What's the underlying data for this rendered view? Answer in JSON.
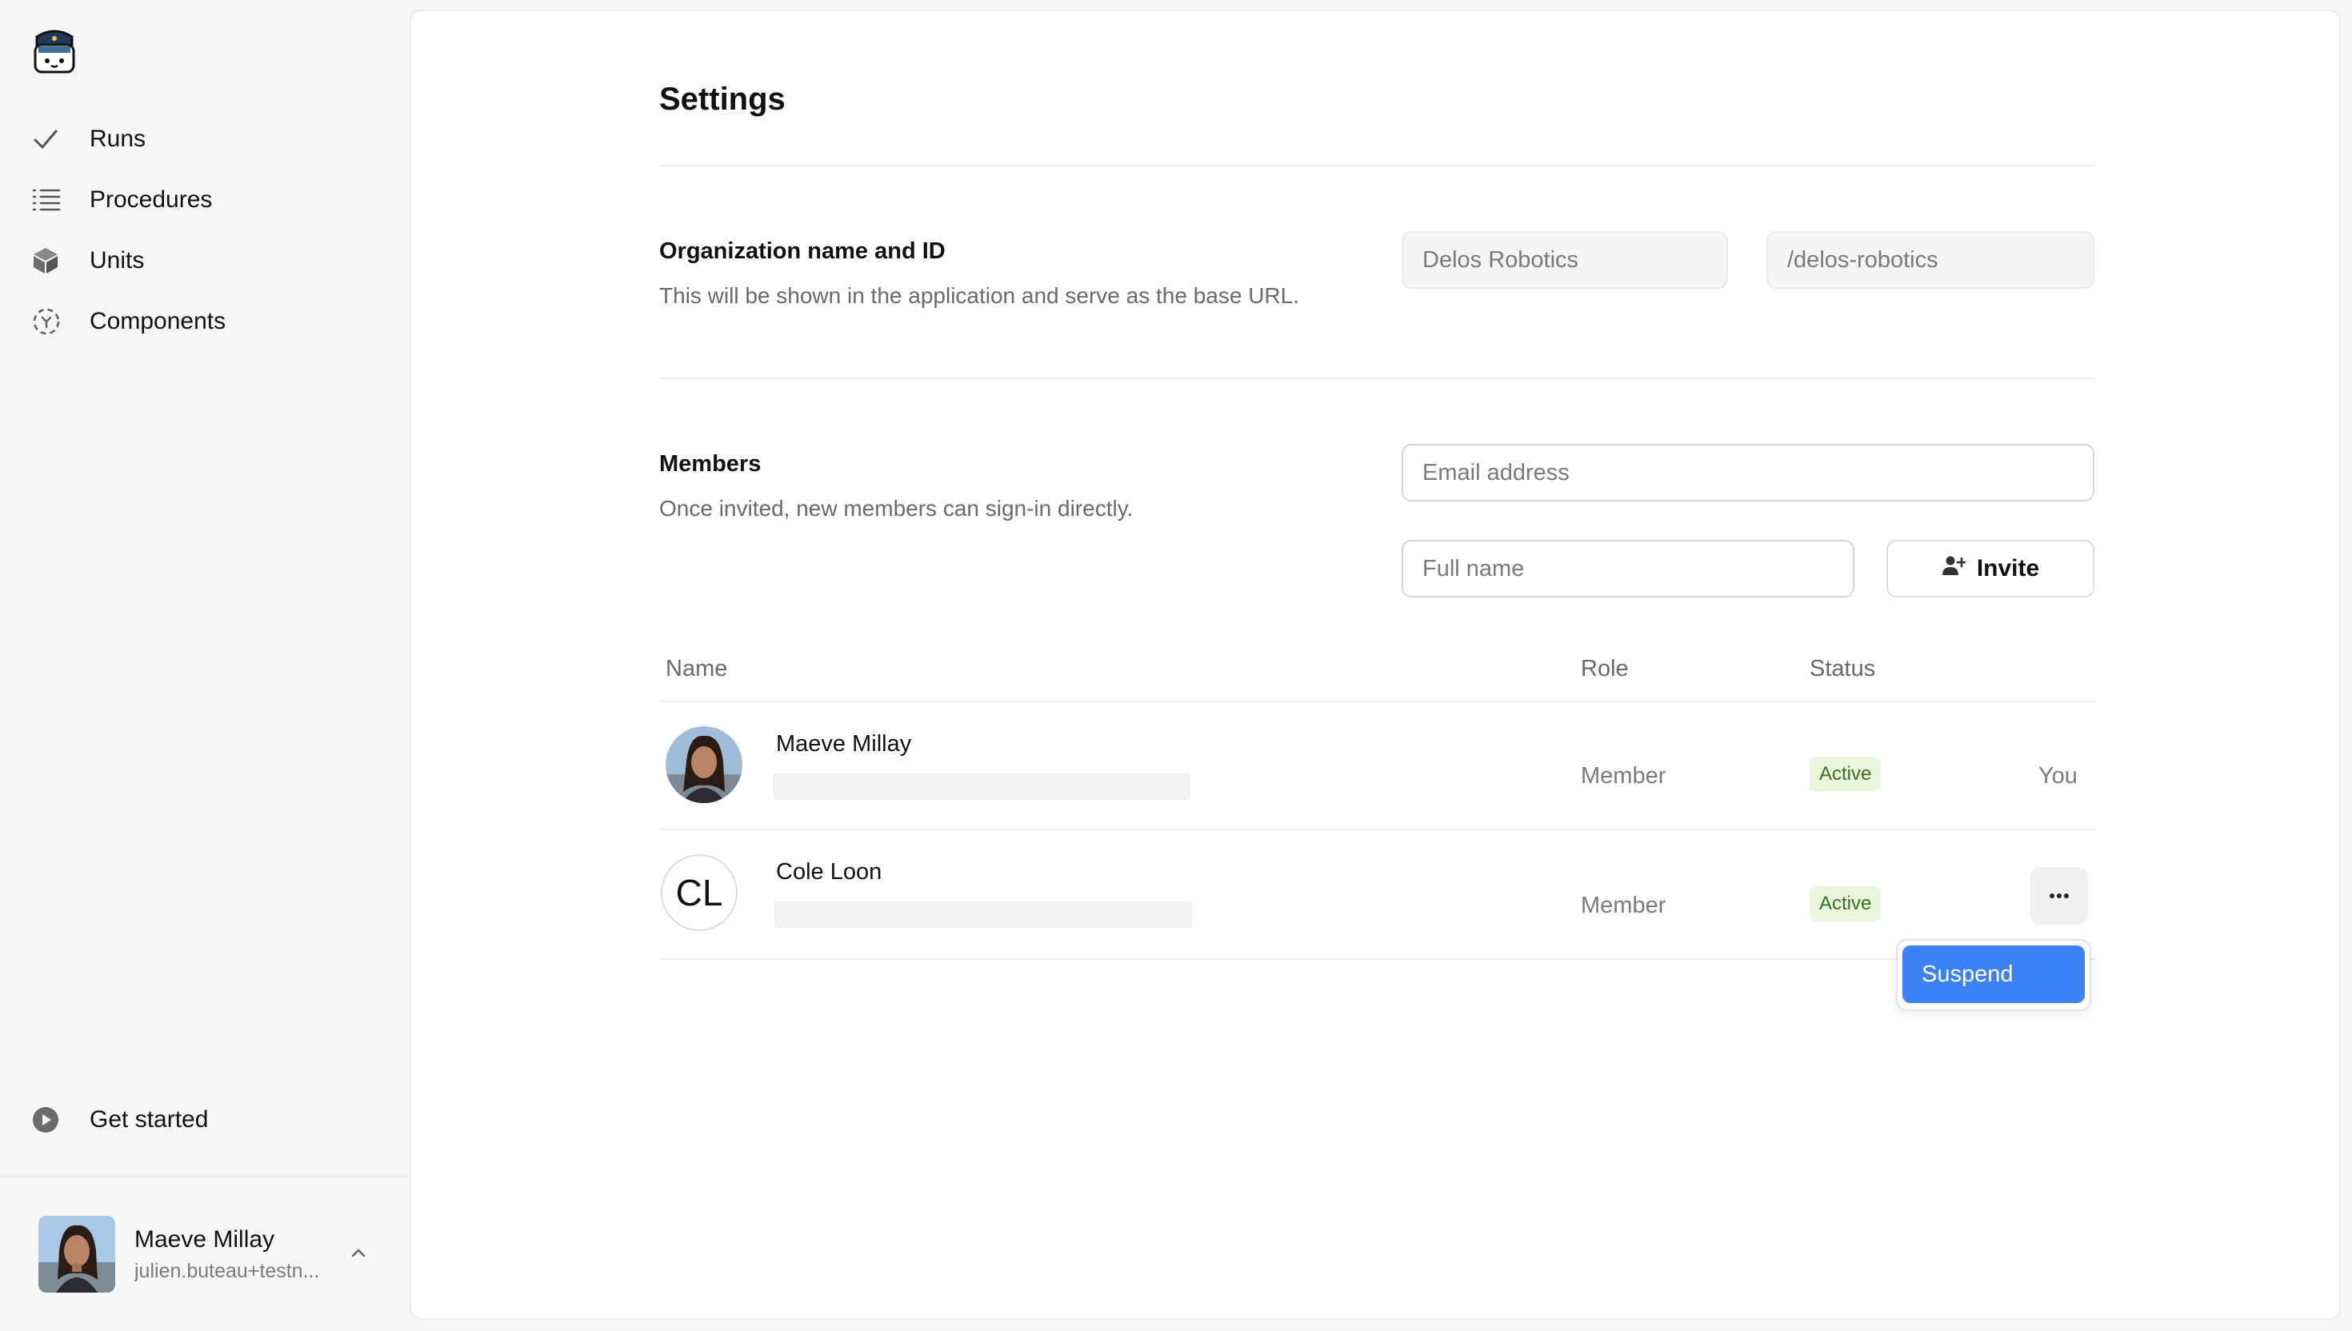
{
  "sidebar": {
    "nav": [
      {
        "label": "Runs",
        "icon": "check-icon"
      },
      {
        "label": "Procedures",
        "icon": "list-icon"
      },
      {
        "label": "Units",
        "icon": "cube-icon"
      },
      {
        "label": "Components",
        "icon": "components-icon"
      }
    ],
    "get_started": "Get started",
    "user": {
      "name": "Maeve Millay",
      "email": "julien.buteau+testn..."
    }
  },
  "page": {
    "title": "Settings"
  },
  "org": {
    "title": "Organization name and ID",
    "description": "This will be shown in the application and serve as the base URL.",
    "name_value": "Delos Robotics",
    "id_value": "/delos-robotics"
  },
  "members": {
    "title": "Members",
    "description": "Once invited, new members can sign-in directly.",
    "email_placeholder": "Email address",
    "fullname_placeholder": "Full name",
    "invite_label": "Invite",
    "columns": {
      "name": "Name",
      "role": "Role",
      "status": "Status"
    },
    "rows": [
      {
        "name": "Maeve Millay",
        "role": "Member",
        "status": "Active",
        "extra": "You"
      },
      {
        "name": "Cole Loon",
        "initials": "CL",
        "role": "Member",
        "status": "Active"
      }
    ],
    "menu": {
      "suspend": "Suspend"
    }
  },
  "colors": {
    "accent": "#3b82f6",
    "badge_bg": "#e9f7dc",
    "badge_text": "#3b6e20"
  }
}
